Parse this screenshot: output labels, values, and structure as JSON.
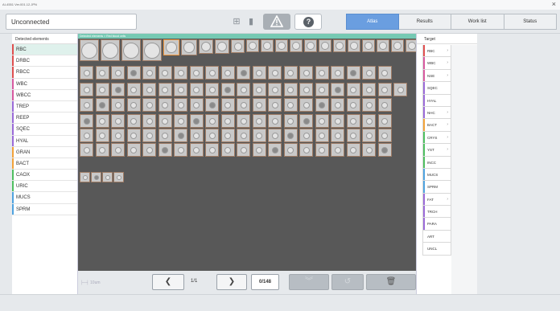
{
  "window": {
    "title": "AI-4551 Ver.001.12.JPN",
    "close_glyph": "×"
  },
  "toolbar": {
    "connection": "Unconnected",
    "tabs": [
      {
        "label": "Atlas",
        "active": true
      },
      {
        "label": "Results",
        "active": false
      },
      {
        "label": "Work list",
        "active": false
      },
      {
        "label": "Status",
        "active": false
      }
    ]
  },
  "left_panel": {
    "header": "Detected elements",
    "items": [
      {
        "label": "RBC",
        "color": "#e05050",
        "active": true
      },
      {
        "label": "DRBC",
        "color": "#e05050"
      },
      {
        "label": "RBCC",
        "color": "#e05050"
      },
      {
        "label": "WBC",
        "color": "#d85aa0"
      },
      {
        "label": "WBCC",
        "color": "#d85aa0"
      },
      {
        "label": "TREP",
        "color": "#9b6bd8"
      },
      {
        "label": "REEP",
        "color": "#9b6bd8"
      },
      {
        "label": "SQEC",
        "color": "#9b6bd8"
      },
      {
        "label": "HYAL",
        "color": "#9b6bd8"
      },
      {
        "label": "GRAN",
        "color": "#f2a33a"
      },
      {
        "label": "BACT",
        "color": "#f2a33a"
      },
      {
        "label": "CAOX",
        "color": "#4fbf60"
      },
      {
        "label": "URIC",
        "color": "#4fbf60"
      },
      {
        "label": "MUCS",
        "color": "#4fa3e0"
      },
      {
        "label": "SPRM",
        "color": "#4fa3e0"
      }
    ]
  },
  "center": {
    "breadcrumb": "Detected elements > Red blood cells",
    "scale_label": "10um",
    "page": "1/1",
    "count": "0/148"
  },
  "right_panel": {
    "header": "Target",
    "items": [
      {
        "label": "RBC",
        "color": "#e05050",
        "chevron": "›"
      },
      {
        "label": "WBC",
        "color": "#d85aa0",
        "chevron": "›"
      },
      {
        "label": "NSE",
        "color": "#d85aa0",
        "chevron": "›"
      },
      {
        "label": "SQEC",
        "color": "#9b6bd8",
        "chevron": ""
      },
      {
        "label": "HYAL",
        "color": "#9b6bd8",
        "chevron": ""
      },
      {
        "label": "NHC",
        "color": "#9b6bd8",
        "chevron": "›"
      },
      {
        "label": "BACT",
        "color": "#f2a33a",
        "chevron": "›"
      },
      {
        "label": "CRYS",
        "color": "#4fbf60",
        "chevron": "›"
      },
      {
        "label": "YST",
        "color": "#4fbf60",
        "chevron": "›"
      },
      {
        "label": "INCC",
        "color": "#4fbf60",
        "chevron": ""
      },
      {
        "label": "MUCS",
        "color": "#4fa3e0",
        "chevron": ""
      },
      {
        "label": "SPRM",
        "color": "#4fa3e0",
        "chevron": ""
      },
      {
        "label": "FAT",
        "color": "#9b6bd8",
        "chevron": "›"
      },
      {
        "label": "TRCH",
        "color": "#9b6bd8",
        "chevron": ""
      },
      {
        "label": "PARA",
        "color": "#9b6bd8",
        "chevron": ""
      },
      {
        "label": "ART",
        "color": "",
        "chevron": ""
      },
      {
        "label": "UNCL",
        "color": "",
        "chevron": ""
      }
    ]
  },
  "colors": {
    "accent": "#6a9ee0",
    "breadcrumb": "#76c9b3",
    "viewer_bg": "#585858"
  }
}
